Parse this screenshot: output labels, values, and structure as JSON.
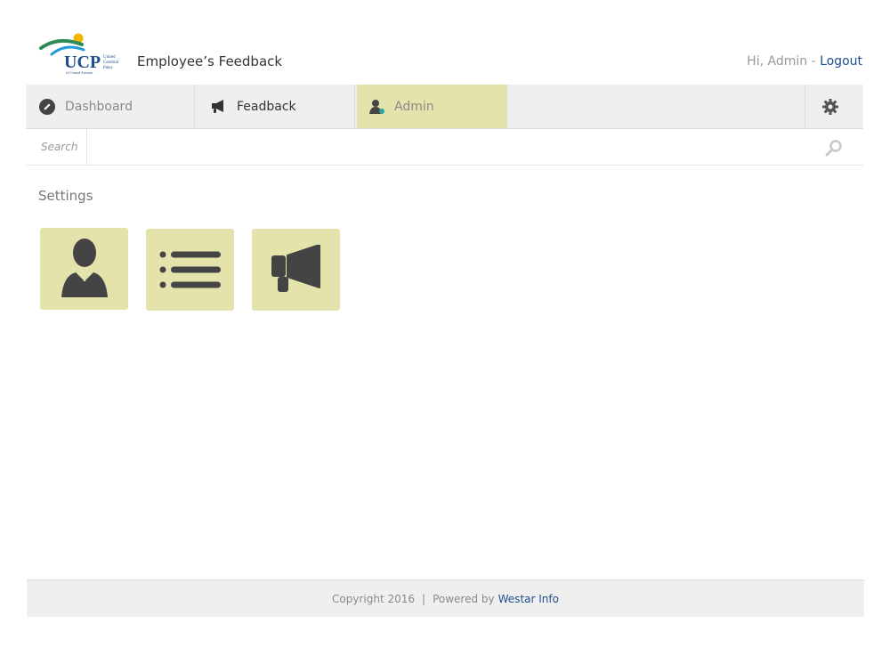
{
  "header": {
    "logo_text": "UCP",
    "logo_tagline": "United Cerebral Palsy of Central Arizona",
    "app_title": "Employee’s Feedback",
    "greeting": "Hi, Admin -",
    "logout_label": "Logout"
  },
  "nav": {
    "items": [
      {
        "label": "Dashboard",
        "icon": "pencil-circle-icon",
        "active": false
      },
      {
        "label": "Feadback",
        "icon": "megaphone-icon",
        "active": false
      },
      {
        "label": "Admin",
        "icon": "admin-user-icon",
        "active": true
      }
    ],
    "settings_icon": "gear-icon"
  },
  "search": {
    "label": "Search",
    "value": "",
    "icon": "magnifier-icon"
  },
  "main": {
    "section_title": "Settings",
    "tiles": [
      {
        "name": "users",
        "icon": "businessman-icon"
      },
      {
        "name": "list",
        "icon": "list-icon"
      },
      {
        "name": "feedback",
        "icon": "megaphone-icon"
      }
    ]
  },
  "footer": {
    "copyright": "Copyright 2016",
    "separator": "|",
    "powered_by": "Powered by",
    "link_label": "Westar Info"
  },
  "colors": {
    "accent": "#e4e3ac",
    "link": "#1e4f8c",
    "nav_bg": "#efefef",
    "icon_dark": "#444444"
  }
}
